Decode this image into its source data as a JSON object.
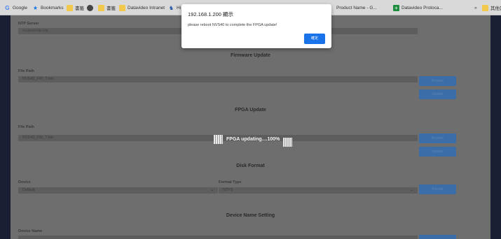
{
  "bookmarks": [
    {
      "label": "Google",
      "icon": "google-icon"
    },
    {
      "label": "Bookmarks",
      "icon": "star-icon"
    },
    {
      "label": "書籤",
      "icon": "folder-icon"
    },
    {
      "label": "",
      "icon": "globe-icon"
    },
    {
      "label": "書籤",
      "icon": "folder-icon"
    },
    {
      "label": "Datavideo Intranet",
      "icon": "folder-icon"
    },
    {
      "label": "Hi",
      "icon": "shoe-icon"
    }
  ],
  "bookmarks_right": [
    {
      "label": "Product Name - G...",
      "icon": "page-icon"
    },
    {
      "label": "Datavideo Protoca...",
      "icon": "sheet-icon"
    }
  ],
  "bookmarks_overflow": "»",
  "bookmarks_other": "其他書",
  "ntp": {
    "label": "NTP Server",
    "value": "cn.pool.ntp.org"
  },
  "firmware": {
    "title": "Firmware Update",
    "file_label": "File Path",
    "file_value": "NVS40_FW_?.bin",
    "browse": "Browse",
    "update": "Update"
  },
  "fpga": {
    "title": "FPGA Update",
    "file_label": "File Path",
    "file_value": "NVS40_FW_?.bin",
    "browse": "Browse",
    "update": "Update",
    "progress_text": "FPGA updating....100%",
    "progress": 1.0
  },
  "disk": {
    "title": "Disk Format",
    "device_label": "Device",
    "device_value": "Default",
    "format_label": "Format Type",
    "format_value": "NTFS",
    "format_button": "Format"
  },
  "device_name": {
    "title": "Device Name Setting",
    "label": "Device Name"
  },
  "dialog": {
    "title": "192.168.1.200 顯示",
    "message": "please reboot NVS40 to complete the FPGA update!",
    "ok": "確定"
  }
}
